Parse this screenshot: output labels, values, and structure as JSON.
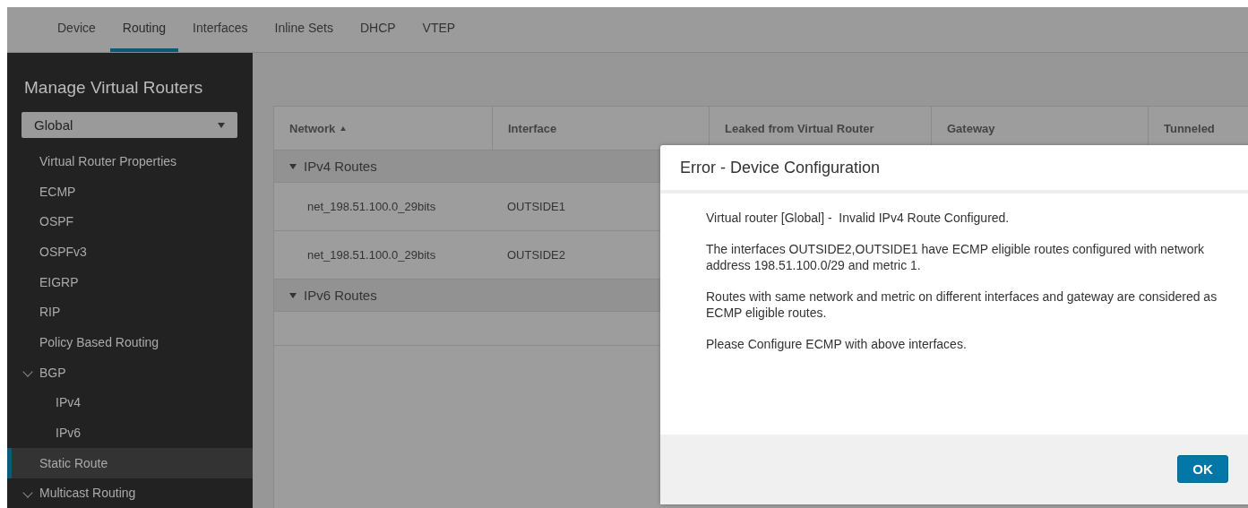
{
  "tabs": [
    {
      "label": "Device",
      "selected": false
    },
    {
      "label": "Routing",
      "selected": true
    },
    {
      "label": "Interfaces",
      "selected": false
    },
    {
      "label": "Inline Sets",
      "selected": false
    },
    {
      "label": "DHCP",
      "selected": false
    },
    {
      "label": "VTEP",
      "selected": false
    }
  ],
  "sidebar": {
    "title": "Manage Virtual Routers",
    "dropdown": {
      "value": "Global"
    },
    "items": [
      {
        "label": "Virtual Router Properties",
        "kind": "link",
        "selected": false
      },
      {
        "label": "ECMP",
        "kind": "link",
        "selected": false
      },
      {
        "label": "OSPF",
        "kind": "link",
        "selected": false
      },
      {
        "label": "OSPFv3",
        "kind": "link",
        "selected": false
      },
      {
        "label": "EIGRP",
        "kind": "link",
        "selected": false
      },
      {
        "label": "RIP",
        "kind": "link",
        "selected": false
      },
      {
        "label": "Policy Based Routing",
        "kind": "link",
        "selected": false
      },
      {
        "label": "BGP",
        "kind": "group",
        "selected": false,
        "expanded": true,
        "children": [
          {
            "label": "IPv4",
            "kind": "link",
            "selected": false
          },
          {
            "label": "IPv6",
            "kind": "link",
            "selected": false
          }
        ]
      },
      {
        "label": "Static Route",
        "kind": "link",
        "selected": true
      },
      {
        "label": "Multicast Routing",
        "kind": "group",
        "selected": false,
        "expanded": true
      }
    ]
  },
  "table": {
    "columns": [
      {
        "label": "Network",
        "sorted": true
      },
      {
        "label": "Interface",
        "sorted": false
      },
      {
        "label": "Leaked from Virtual Router",
        "sorted": false
      },
      {
        "label": "Gateway",
        "sorted": false
      },
      {
        "label": "Tunneled",
        "sorted": false
      }
    ],
    "groups": [
      {
        "label": "IPv4 Routes",
        "expanded": true,
        "rows": [
          {
            "network": "net_198.51.100.0_29bits",
            "interface": "OUTSIDE1"
          },
          {
            "network": "net_198.51.100.0_29bits",
            "interface": "OUTSIDE2"
          }
        ]
      },
      {
        "label": "IPv6 Routes",
        "expanded": true
      }
    ]
  },
  "dialog": {
    "title": "Error - Device Configuration",
    "paragraphs": [
      "Virtual router [Global] -  Invalid IPv4 Route Configured.",
      "The interfaces OUTSIDE2,OUTSIDE1 have ECMP eligible routes configured with network address 198.51.100.0/29 and metric 1.",
      "Routes with same network and metric on different interfaces and gateway are considered as ECMP eligible routes.",
      "Please Configure ECMP with above interfaces."
    ],
    "button": "OK"
  }
}
